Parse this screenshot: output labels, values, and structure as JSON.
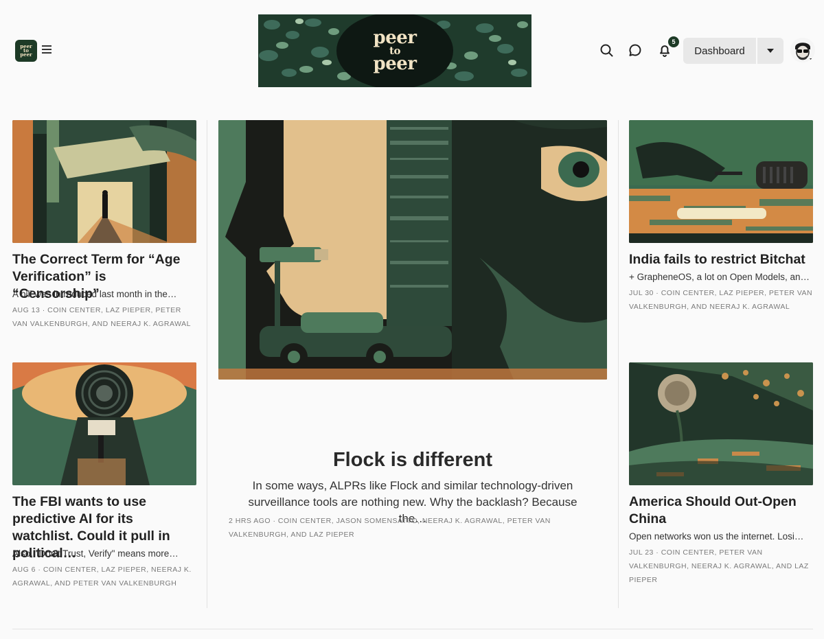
{
  "header": {
    "logo_small_text": [
      "peer",
      "to",
      "peer"
    ],
    "banner_text": [
      "peer",
      "to",
      "peer"
    ],
    "notification_count": "5",
    "dashboard_label": "Dashboard",
    "icons": [
      "search-icon",
      "chat-icon",
      "bell-icon",
      "caret-down-icon",
      "avatar"
    ]
  },
  "posts": [
    {
      "title": "The Correct Term for “Age Verification” is “Censorship”",
      "subtitle": "A bill was introduced last month in the…",
      "meta": "AUG 13 · COIN CENTER, LAZ PIEPER, PETER VAN VALKENBURGH, AND NEERAJ K. AGRAWAL"
    },
    {
      "title": "The FBI wants to use predictive AI for its watchlist. Could it pull in political…",
      "subtitle": "Also, \"Don't Trust, Verify\" means more…",
      "meta": "AUG 6 · COIN CENTER, LAZ PIEPER, NEERAJ K. AGRAWAL, AND PETER VAN VALKENBURGH"
    },
    {
      "title": "Flock is different",
      "subtitle": "In some ways, ALPRs like Flock and similar technology-driven surveillance tools are nothing new. Why the backlash? Because the…",
      "meta": "2 HRS AGO · COIN CENTER, JASON SOMENSATTO, NEERAJ K. AGRAWAL, PETER VAN VALKENBURGH, AND LAZ PIEPER"
    },
    {
      "title": "India fails to restrict Bitchat",
      "subtitle": "+ GrapheneOS, a lot on Open Models, an…",
      "meta": "JUL 30 · COIN CENTER, LAZ PIEPER, PETER VAN VALKENBURGH, AND NEERAJ K. AGRAWAL"
    },
    {
      "title": "America Should Out-Open China",
      "subtitle": "Open networks won us the internet. Losi…",
      "meta": "JUL 23 · COIN CENTER, PETER VAN VALKENBURGH, NEERAJ K. AGRAWAL, AND LAZ PIEPER"
    }
  ],
  "colors": {
    "brand_green": "#1d3a26",
    "cream": "#f1e3c4",
    "muted_green": "#4e7a5c"
  }
}
